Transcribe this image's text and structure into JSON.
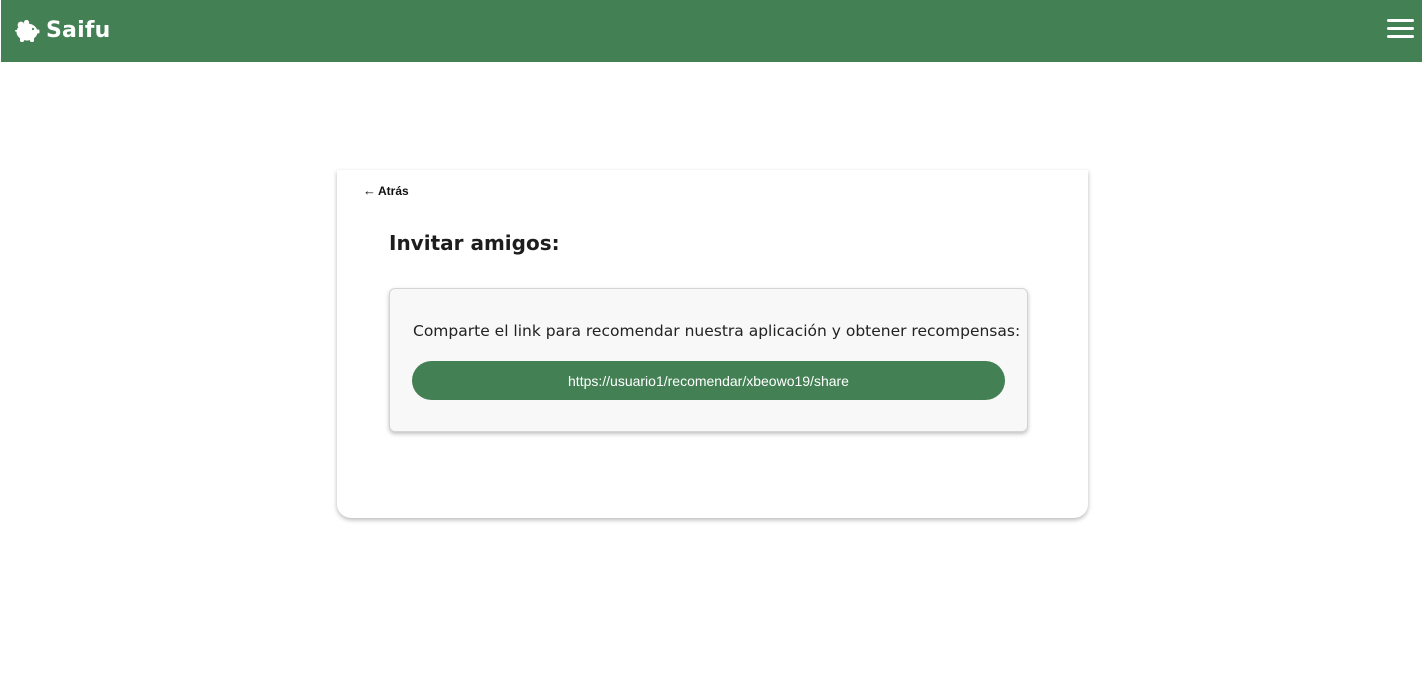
{
  "header": {
    "app_name": "Saifu",
    "logo_icon": "piggy-bank-icon",
    "menu_icon": "hamburger-menu-icon",
    "background_color": "#438054"
  },
  "card": {
    "back_label": "Atrás",
    "back_arrow": "←",
    "title": "Invitar amigos:",
    "share_text": "Comparte el link para recomendar nuestra aplicación y obtener recompensas:",
    "share_link": "https://usuario1/recomendar/xbeowo19/share"
  },
  "colors": {
    "accent": "#438054",
    "text": "#1d1d1d"
  }
}
